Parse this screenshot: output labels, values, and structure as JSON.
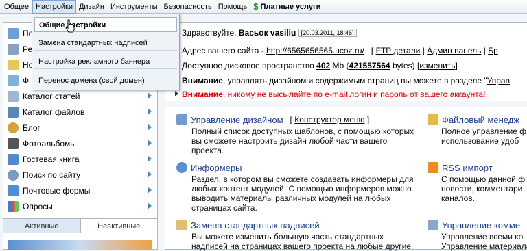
{
  "menubar": {
    "items": [
      "Общее",
      "Настройки",
      "Дизайн",
      "Инструменты",
      "Безопасность",
      "Помощь"
    ],
    "paid": "Платные услуги"
  },
  "dropdown": {
    "items": [
      "Общие настройки",
      "Замена стандартных надписей",
      "Настройка рекламного баннера",
      "Перенос домена (свой домен)"
    ]
  },
  "sidebar": {
    "items": [
      "По",
      "Ре",
      "Но",
      "Ф",
      "Каталог статей",
      "Каталог файлов",
      "Блог",
      "Фотоальбомы",
      "Гостевая книга",
      "Поиск по сайту",
      "Почтовые формы",
      "Опросы"
    ],
    "tabs": [
      "Активные",
      "Неактивные"
    ]
  },
  "main": {
    "greeting": "Здравствуйте,",
    "user": "Васьок vasiliu",
    "date": "[20.03.2011, 18:46]",
    "addr_label": "Адрес вашего сайта -",
    "addr_url": "http://6565656565.ucoz.ru/",
    "ftp": "FTP детали",
    "admin": "Админ панель",
    "br": "Бр",
    "disk_label": "Доступное дисковое пространство",
    "disk_mb": "402",
    "disk_mb_unit": "Mb",
    "disk_bytes": "421557564",
    "disk_bytes_unit": "bytes)",
    "change": "изменить",
    "attn1_bold": "Внимание",
    "attn1_text": ", управлять дизайном и содержимым страниц вы можете в разделе \"",
    "attn1_link": "Управ",
    "attn2_bold": "Внимание",
    "attn2_text": ", никому не высылайте по e-mail логин и пароль от вашего аккаунта!"
  },
  "cards": {
    "design_title": "Управление дизайном",
    "design_link": "Конструктор меню",
    "design_desc": [
      "Полный список доступных шаблонов, с помощью которых",
      "вы сможете настроить дизайн любой части вашего",
      "проекта."
    ],
    "informers_title": "Информеры",
    "informers_desc": [
      "Раздел, в котором вы сможете создавать информеры для",
      "любых контент модулей. С помощью информеров можно",
      "выводить материалы различных модулей на любых",
      "страницах сайта."
    ],
    "replace_title": "Замена стандартных надписей",
    "replace_desc": [
      "Вы можете изменить большую часть стандартных",
      "надписей на страницах вашего проекта на любые другие."
    ],
    "files_title": "Файловый менедж",
    "files_desc": [
      "Полное управление ф",
      "использование удоб"
    ],
    "rss_title": "RSS импорт",
    "rss_desc": [
      "С помощью данной ф",
      "новости, комментари",
      "каналов."
    ],
    "comments_title": "Управление комме",
    "comments_desc": [
      "Управление всеми ко",
      "Управление материала"
    ]
  }
}
